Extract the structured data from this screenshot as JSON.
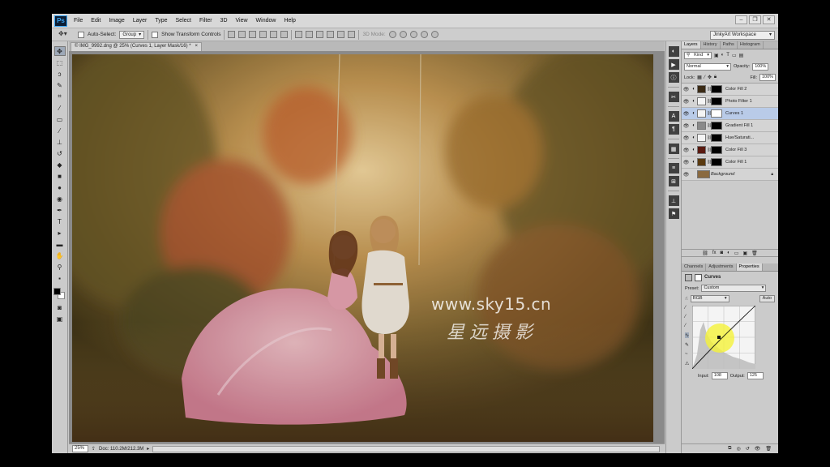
{
  "app": {
    "logo": "Ps",
    "menu": [
      "File",
      "Edit",
      "Image",
      "Layer",
      "Type",
      "Select",
      "Filter",
      "3D",
      "View",
      "Window",
      "Help"
    ],
    "window_controls": [
      "–",
      "❐",
      "✕"
    ]
  },
  "options_bar": {
    "auto_select_label": "Auto-Select:",
    "auto_select_value": "Group",
    "show_transform_label": "Show Transform Controls",
    "mode_3d_label": "3D Mode:",
    "workspace": "JinkyArt Workspace"
  },
  "document": {
    "tab_title": "© IMG_9992.dng @ 25% (Curves 1, Layer Mask/16) *",
    "tab_close": "×",
    "zoom": "25%",
    "doc_info": "Doc: 110.2M/212.3M",
    "watermark_url": "www.sky15.cn",
    "watermark_cn": "星远摄影"
  },
  "layers_panel": {
    "tabs": [
      "Layers",
      "History",
      "Paths",
      "Histogram"
    ],
    "filter_kind": "Kind",
    "blend_mode": "Normal",
    "opacity_label": "Opacity:",
    "opacity_value": "100%",
    "lock_label": "Lock:",
    "fill_label": "Fill:",
    "fill_value": "100%",
    "layers": [
      {
        "name": "Color Fill 2",
        "thumb": "#3a2a14",
        "selected": false
      },
      {
        "name": "Photo Filter 1",
        "thumb": "#f4f4f4",
        "selected": false
      },
      {
        "name": "Curves 1",
        "thumb": "#f4f4f4",
        "selected": true
      },
      {
        "name": "Gradient Fill 1",
        "thumb": "#8a8a8a",
        "selected": false
      },
      {
        "name": "Hue/Saturati...",
        "thumb": "#f4f4f4",
        "selected": false
      },
      {
        "name": "Color Fill 3",
        "thumb": "#5a1a10",
        "selected": false
      },
      {
        "name": "Color Fill 1",
        "thumb": "#5a3a10",
        "selected": false
      },
      {
        "name": "Background",
        "thumb": "#8a6a40",
        "selected": false
      }
    ]
  },
  "properties_panel": {
    "tabs": [
      "Channels",
      "Adjustments",
      "Properties"
    ],
    "title": "Curves",
    "preset_label": "Preset:",
    "preset_value": "Custom",
    "channel_value": "RGB",
    "auto_label": "Auto",
    "input_label": "Input:",
    "input_value": "108",
    "output_label": "Output:",
    "output_value": "125"
  },
  "colors": {
    "selected_layer": "#b9cbe8",
    "curve_highlight": "#f5f23a"
  }
}
